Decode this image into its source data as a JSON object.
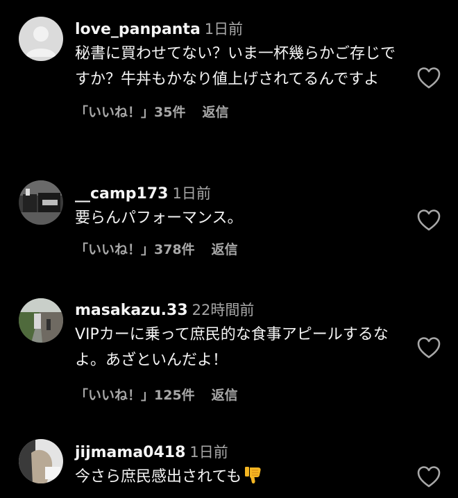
{
  "comments": [
    {
      "username": "love_panpanta",
      "time": "1日前",
      "text": "秘書に買わせてない？いま一杯幾らかご存じですか？牛丼もかなり値上げされてるんですよ",
      "likes_label": "「いいね！」35件",
      "reply_label": "返信",
      "avatar_icon": "default-avatar-icon"
    },
    {
      "username": "__camp173",
      "time": "1日前",
      "text": "要らんパフォーマンス。",
      "likes_label": "「いいね！」378件",
      "reply_label": "返信",
      "avatar_icon": "camp-photo-avatar"
    },
    {
      "username": "masakazu.33",
      "time": "22時間前",
      "text": "VIPカーに乗って庶民的な食事アピールするなよ。あざといんだよ！",
      "likes_label": "「いいね！」125件",
      "reply_label": "返信",
      "avatar_icon": "street-photo-avatar"
    },
    {
      "username": "jijmama0418",
      "time": "1日前",
      "text": "今さら庶民感出されても",
      "emoji": "thumbs-down-icon",
      "avatar_icon": "photo-avatar"
    }
  ],
  "colors": {
    "background": "#000000",
    "primary_text": "#f5f5f5",
    "secondary_text": "#a8a8a8",
    "emoji": "#f5b622"
  }
}
